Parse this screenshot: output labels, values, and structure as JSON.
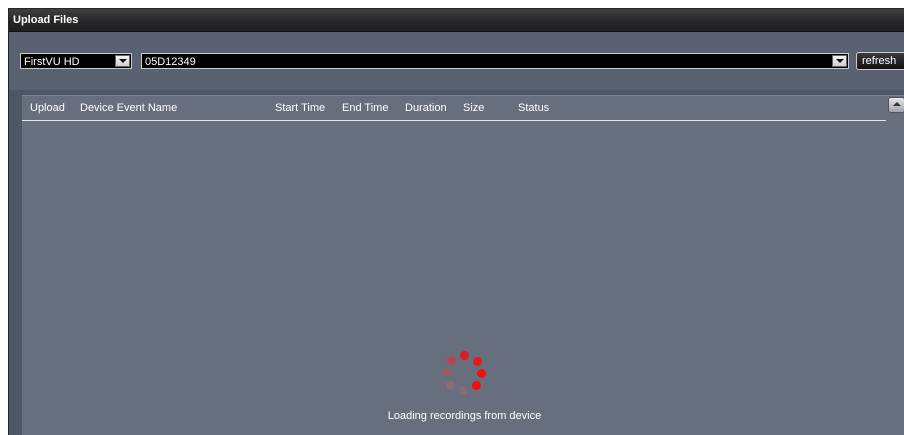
{
  "window": {
    "title": "Upload Files"
  },
  "toolbar": {
    "device_type": "FirstVU HD",
    "camera_id": "05D12349",
    "refresh_label": "refresh"
  },
  "table": {
    "columns": [
      "Upload",
      "Device Event Name",
      "Start Time",
      "End Time",
      "Duration",
      "Size",
      "Status"
    ]
  },
  "status": {
    "loading_message": "Loading recordings from device"
  },
  "colors": {
    "panel_bg": "#676e7e",
    "toolbar_bg": "#5a6170",
    "spinner_red": "#e8191e"
  },
  "icons": [
    "dropdown-arrow-icon",
    "scroll-up-icon",
    "loading-spinner-icon"
  ]
}
